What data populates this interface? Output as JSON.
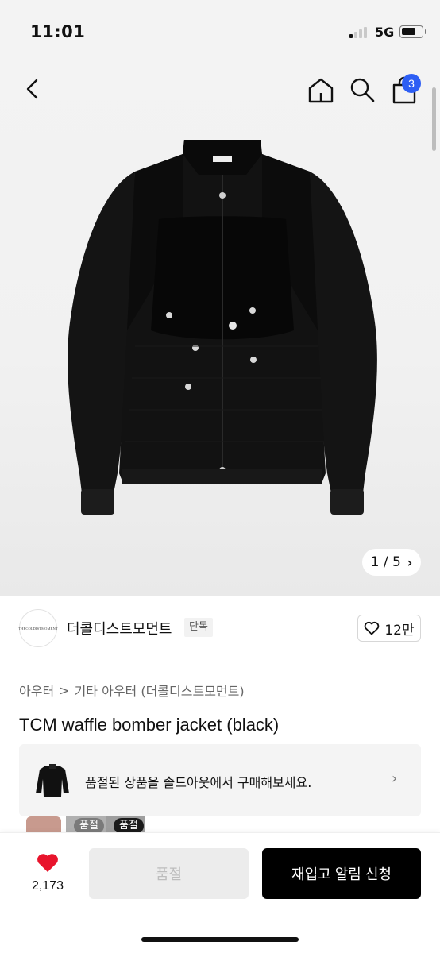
{
  "status_bar": {
    "time": "11:01",
    "network": "5G"
  },
  "nav": {
    "cart_count": "3"
  },
  "gallery": {
    "counter": "1 / 5",
    "counter_chevron": "›"
  },
  "seller": {
    "logo_text": "THECOLDISTMOMENT",
    "name": "더콜디스트모먼트",
    "badge": "단독",
    "likes": "12만"
  },
  "breadcrumb": {
    "level1": "아우터",
    "separator": ">",
    "level2": "기타 아우터 (더콜디스트모먼트)"
  },
  "product": {
    "title": "TCM waffle bomber jacket (black)"
  },
  "soldout_banner": {
    "text": "품절된 상품을 솔드아웃에서 구매해보세요.",
    "chevron": "›"
  },
  "variants": [
    {
      "tag": ""
    },
    {
      "tag": "품절"
    },
    {
      "tag": "품절"
    }
  ],
  "bottom_bar": {
    "wish_count": "2,173",
    "soldout_label": "품절",
    "restock_label": "재입고 알림 신청"
  },
  "colors": {
    "accent": "#2d5ef4",
    "heart": "#e8142c",
    "primary_button": "#000000"
  }
}
